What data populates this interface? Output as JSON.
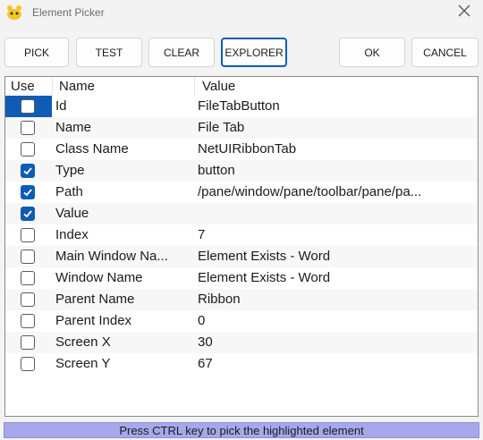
{
  "window": {
    "title": "Element Picker",
    "icon": "app-bird-icon",
    "close_icon": "close-icon"
  },
  "toolbar": {
    "pick": "PICK",
    "test": "TEST",
    "clear": "CLEAR",
    "explorer": "EXPLORER",
    "ok": "OK",
    "cancel": "CANCEL"
  },
  "grid": {
    "headers": {
      "use": "Use",
      "name": "Name",
      "value": "Value"
    },
    "rows": [
      {
        "name": "Id",
        "value": "FileTabButton",
        "checked": false,
        "selected": true
      },
      {
        "name": "Name",
        "value": "File Tab",
        "checked": false
      },
      {
        "name": "Class Name",
        "value": "NetUIRibbonTab",
        "checked": false
      },
      {
        "name": "Type",
        "value": "button",
        "checked": true
      },
      {
        "name": "Path",
        "value": "/pane/window/pane/toolbar/pane/pa...",
        "checked": true
      },
      {
        "name": "Value",
        "value": "",
        "checked": true
      },
      {
        "name": "Index",
        "value": "7",
        "checked": false
      },
      {
        "name": "Main Window Na...",
        "value": "Element Exists - Word",
        "checked": false
      },
      {
        "name": "Window Name",
        "value": "Element Exists - Word",
        "checked": false
      },
      {
        "name": "Parent Name",
        "value": "Ribbon",
        "checked": false
      },
      {
        "name": "Parent Index",
        "value": "0",
        "checked": false
      },
      {
        "name": "Screen X",
        "value": "30",
        "checked": false
      },
      {
        "name": "Screen Y",
        "value": "67",
        "checked": false
      }
    ]
  },
  "status": {
    "text": "Press CTRL key to pick the highlighted element"
  },
  "colors": {
    "accent": "#0f5bb5",
    "status_bg": "#a7a7ec",
    "window_bg": "#f3f3f3"
  }
}
